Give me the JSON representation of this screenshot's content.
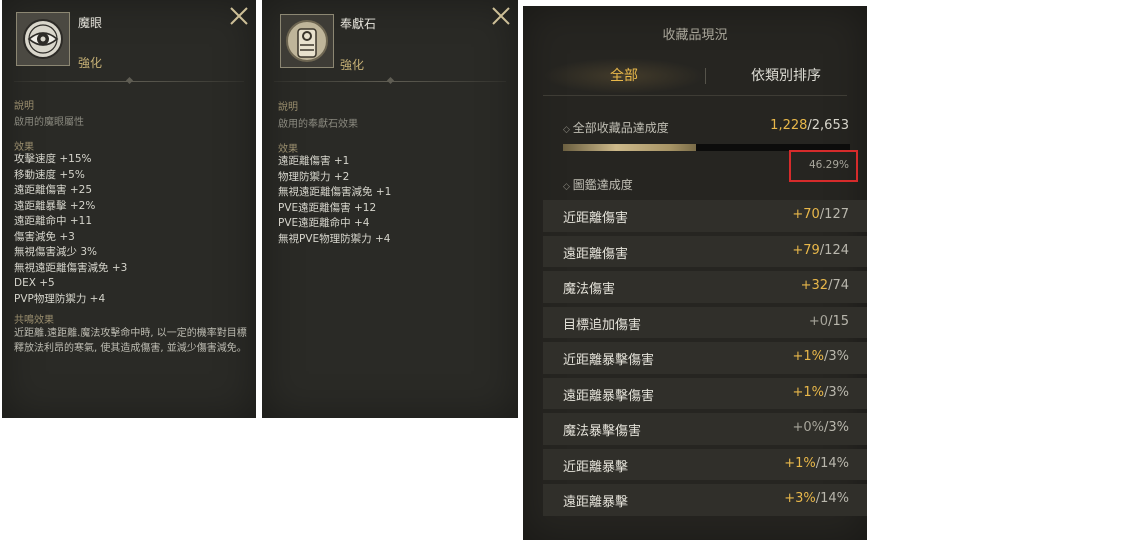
{
  "panel1": {
    "name": "魔眼",
    "subtitle": "強化",
    "desc_title": "說明",
    "desc_text": "啟用的魔眼屬性",
    "effects_title": "效果",
    "effects": [
      "攻擊速度 +15%",
      "移動速度 +5%",
      "遠距離傷害 +25",
      "遠距離暴擊 +2%",
      "遠距離命中 +11",
      "傷害減免 +3",
      "無視傷害減少 3%",
      "無視遠距離傷害減免 +3",
      "DEX +5",
      "PVP物理防禦力 +4"
    ],
    "resonance_title": "共鳴效果",
    "resonance_text": "近距離.遠距離.魔法攻擊命中時, 以一定的機率對目標釋放法利昂的寒氣, 使其造成傷害, 並減少傷害減免。",
    "icon": "eye-emblem-icon"
  },
  "panel2": {
    "name": "奉獻石",
    "subtitle": "強化",
    "desc_title": "說明",
    "desc_text": "啟用的奉獻石效果",
    "effects_title": "效果",
    "effects": [
      "遠距離傷害 +1",
      "物理防禦力 +2",
      "無視遠距離傷害減免 +1",
      "PVE遠距離傷害 +12",
      "PVE遠距離命中 +4",
      "無視PVE物理防禦力 +4"
    ],
    "icon": "statue-emblem-icon"
  },
  "collection": {
    "title": "收藏品現況",
    "tabs": [
      "全部",
      "依類別排序"
    ],
    "total_label": "全部收藏品達成度",
    "total_current": "1,228",
    "total_max": "/2,653",
    "percent_text": "46.29%",
    "percent_value": 0.4629,
    "guide_label": "圖鑑達成度",
    "rows": [
      {
        "name": "近距離傷害",
        "cur": "+70",
        "max": "/127",
        "highlight": true
      },
      {
        "name": "遠距離傷害",
        "cur": "+79",
        "max": "/124",
        "highlight": true
      },
      {
        "name": "魔法傷害",
        "cur": "+32",
        "max": "/74",
        "highlight": true
      },
      {
        "name": "目標追加傷害",
        "cur": "+0",
        "max": "/15",
        "highlight": false
      },
      {
        "name": "近距離暴擊傷害",
        "cur": "+1%",
        "max": "/3%",
        "highlight": true
      },
      {
        "name": "遠距離暴擊傷害",
        "cur": "+1%",
        "max": "/3%",
        "highlight": true
      },
      {
        "name": "魔法暴擊傷害",
        "cur": "+0%",
        "max": "/3%",
        "highlight": false
      },
      {
        "name": "近距離暴擊",
        "cur": "+1%",
        "max": "/14%",
        "highlight": true
      },
      {
        "name": "遠距離暴擊",
        "cur": "+3%",
        "max": "/14%",
        "highlight": true
      }
    ]
  },
  "colors": {
    "accent": "#e9b84a",
    "panel": "#2a2a26",
    "highlight_box": "#d62b2b"
  }
}
